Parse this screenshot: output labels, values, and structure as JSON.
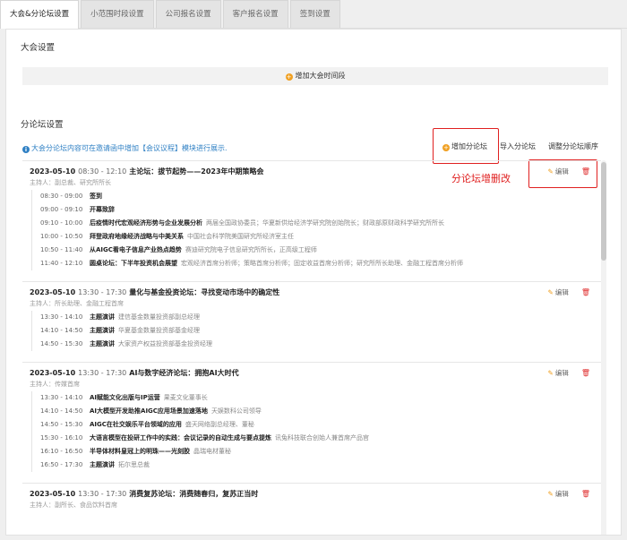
{
  "tabs": [
    "大会&分论坛设置",
    "小范围时段设置",
    "公司报名设置",
    "客户报名设置",
    "签到设置"
  ],
  "conference": {
    "title": "大会设置",
    "add_period": "增加大会时间段"
  },
  "forum": {
    "title": "分论坛设置",
    "info": "大会分论坛内容可在邀请函中增加【会议议程】模块进行展示.",
    "add_btn": "增加分论坛",
    "import_btn": "导入分论坛",
    "order_btn": "调整分论坛顺序",
    "annotation": "分论坛增删改",
    "edit_label": "编辑",
    "sessions": [
      {
        "date": "2023-05-10",
        "time": "08:30 - 12:10",
        "topic": "主论坛：拔节起势——2023年中期策略会",
        "host": "主持人：副总裁、研究所所长",
        "items": [
          {
            "t": "08:30 - 09:00",
            "ti": "签到",
            "sp": ""
          },
          {
            "t": "09:00 - 09:10",
            "ti": "开幕致辞",
            "sp": ""
          },
          {
            "t": "09:10 - 10:00",
            "ti": "后疫情时代宏观经济形势与企业发展分析",
            "sp": "两届全国政协委员；华夏新供给经济学研究院创始院长；财政部原财政科学研究所所长"
          },
          {
            "t": "10:00 - 10:50",
            "ti": "拜登政府地缘经济战略与中美关系",
            "sp": "中国社会科学院美国研究所经济室主任"
          },
          {
            "t": "10:50 - 11:40",
            "ti": "从AIGC看电子信息产业热点趋势",
            "sp": "赛迪研究院电子信息研究所所长，正高级工程师"
          },
          {
            "t": "11:40 - 12:10",
            "ti": "圆桌论坛：下半年投资机会展望",
            "sp": "宏观经济首席分析师；策略首席分析师；固定收益首席分析师；研究所所长助理、金融工程首席分析师"
          }
        ]
      },
      {
        "date": "2023-05-10",
        "time": "13:30 - 17:30",
        "topic": "量化与基金投资论坛：寻找变动市场中的确定性",
        "host": "主持人：所长助理、金融工程首席",
        "items": [
          {
            "t": "13:30 - 14:10",
            "ti": "主题演讲",
            "sp": "建信基金数量投资部副总经理"
          },
          {
            "t": "14:10 - 14:50",
            "ti": "主题演讲",
            "sp": "华夏基金数量投资部基金经理"
          },
          {
            "t": "14:50 - 15:30",
            "ti": "主题演讲",
            "sp": "大家资产权益投资部基金投资经理"
          }
        ]
      },
      {
        "date": "2023-05-10",
        "time": "13:30 - 17:30",
        "topic": "AI与数字经济论坛：拥抱AI大时代",
        "host": "主持人：传媒首席",
        "items": [
          {
            "t": "13:30 - 14:10",
            "ti": "AI赋能文化出版与IP运营",
            "sp": "果麦文化董事长"
          },
          {
            "t": "14:10 - 14:50",
            "ti": "AI大模型开发助推AIGC应用场景加速落地",
            "sp": "天娱数科公司领导"
          },
          {
            "t": "14:50 - 15:30",
            "ti": "AIGC在社交娱乐平台领域的应用",
            "sp": "盛天网络副总经理、董秘"
          },
          {
            "t": "15:30 - 16:10",
            "ti": "大语言模型在投研工作中的实践：会议记录的自动生成与要点提炼",
            "sp": "讯兔科技联合创始人兼首席产品官"
          },
          {
            "t": "16:10 - 16:50",
            "ti": "半导体材料皇冠上的明珠——光刻胶",
            "sp": "晶瑞电材董秘"
          },
          {
            "t": "16:50 - 17:30",
            "ti": "主题演讲",
            "sp": "拓尔思总裁"
          }
        ]
      },
      {
        "date": "2023-05-10",
        "time": "13:30 - 17:30",
        "topic": "消费复苏论坛：消费随春归，复苏正当时",
        "host": "主持人：副所长、食品饮料首席",
        "items": []
      }
    ]
  },
  "colors": {
    "accent_orange": "#f0a022",
    "info_blue": "#2f80c4",
    "annotation_red": "#e02020"
  },
  "icons": [
    "plus-circle-icon",
    "info-icon",
    "edit-icon",
    "trash-icon"
  ]
}
